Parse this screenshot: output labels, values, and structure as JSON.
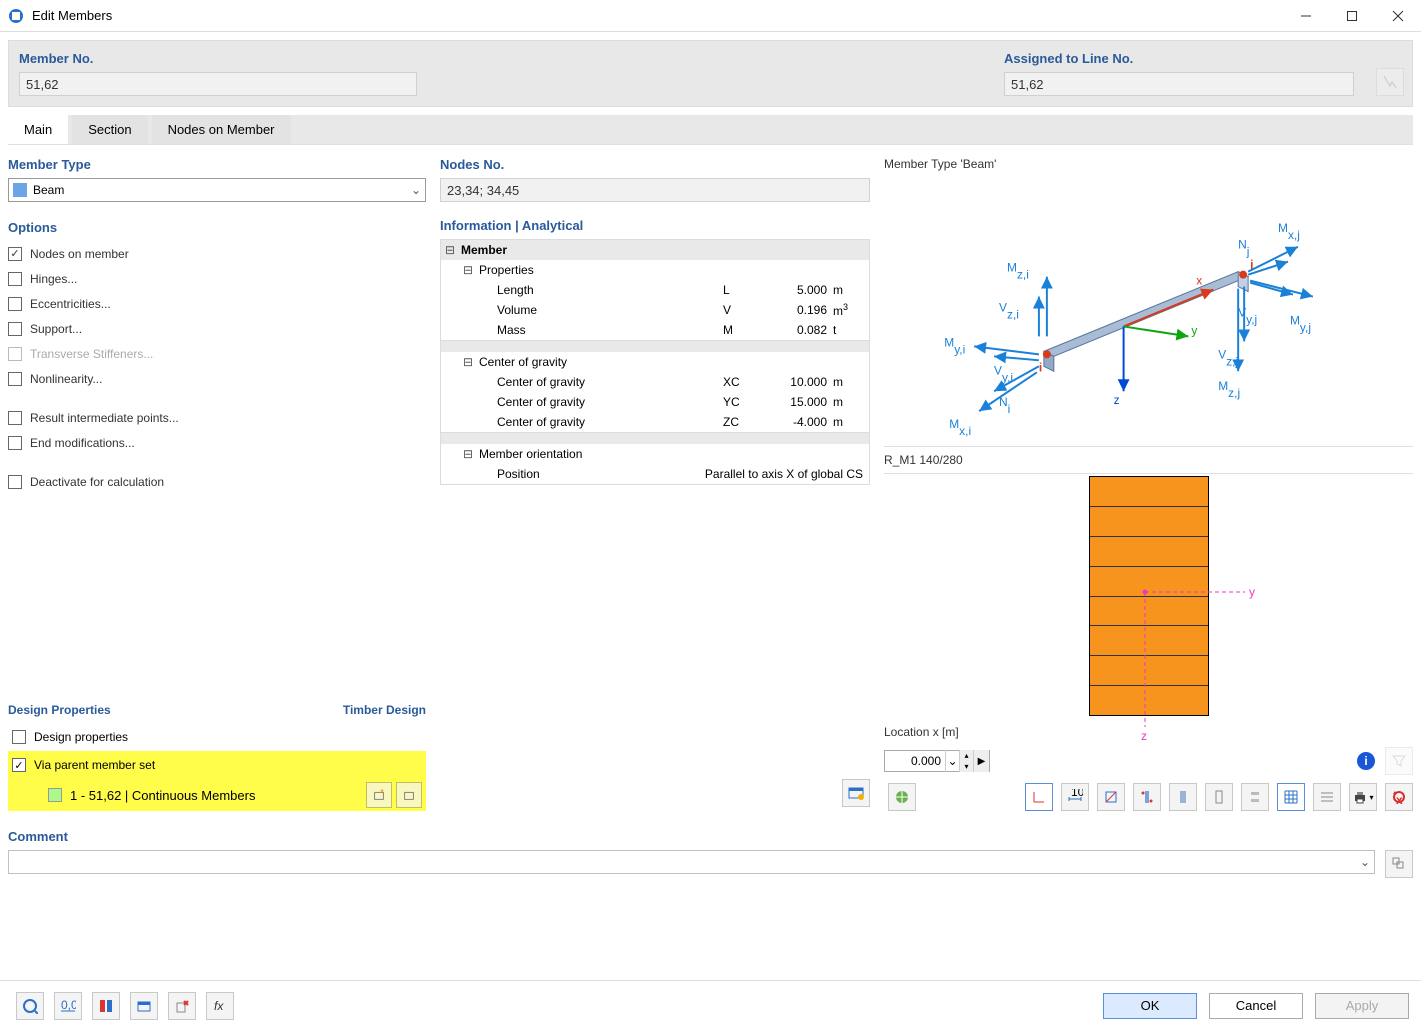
{
  "window": {
    "title": "Edit Members"
  },
  "header": {
    "member_no": {
      "label": "Member No.",
      "value": "51,62"
    },
    "assigned": {
      "label": "Assigned to Line No.",
      "value": "51,62"
    }
  },
  "tabs": [
    "Main",
    "Section",
    "Nodes on Member"
  ],
  "member_type": {
    "label": "Member Type",
    "value": "Beam"
  },
  "options": {
    "label": "Options",
    "items": [
      {
        "label": "Nodes on member",
        "checked": true,
        "disabled": false
      },
      {
        "label": "Hinges...",
        "checked": false,
        "disabled": false
      },
      {
        "label": "Eccentricities...",
        "checked": false,
        "disabled": false
      },
      {
        "label": "Support...",
        "checked": false,
        "disabled": false
      },
      {
        "label": "Transverse Stiffeners...",
        "checked": false,
        "disabled": true
      },
      {
        "label": "Nonlinearity...",
        "checked": false,
        "disabled": false
      },
      {
        "label": "Result intermediate points...",
        "checked": false,
        "disabled": false
      },
      {
        "label": "End modifications...",
        "checked": false,
        "disabled": false
      },
      {
        "label": "Deactivate for calculation",
        "checked": false,
        "disabled": false
      }
    ]
  },
  "design_properties": {
    "label": "Design Properties",
    "right_label": "Timber Design",
    "items": [
      {
        "label": "Design properties",
        "checked": false,
        "highlight": false
      },
      {
        "label": "Via parent member set",
        "checked": true,
        "highlight": true
      }
    ],
    "child": {
      "label": "1 - 51,62 | Continuous Members"
    }
  },
  "nodes_no": {
    "label": "Nodes No.",
    "value": "23,34; 34,45"
  },
  "info_header": "Information | Analytical",
  "info": {
    "member": "Member",
    "properties": "Properties",
    "rows_p": [
      {
        "lbl": "Length",
        "sym": "L",
        "val": "5.000",
        "unit": "m"
      },
      {
        "lbl": "Volume",
        "sym": "V",
        "val": "0.196",
        "unit": "m³"
      },
      {
        "lbl": "Mass",
        "sym": "M",
        "val": "0.082",
        "unit": "t"
      }
    ],
    "cog": "Center of gravity",
    "rows_c": [
      {
        "lbl": "Center of gravity",
        "sym": "XC",
        "val": "10.000",
        "unit": "m"
      },
      {
        "lbl": "Center of gravity",
        "sym": "YC",
        "val": "15.000",
        "unit": "m"
      },
      {
        "lbl": "Center of gravity",
        "sym": "ZC",
        "val": "-4.000",
        "unit": "m"
      }
    ],
    "orient": "Member orientation",
    "pos_lbl": "Position",
    "pos_val": "Parallel to axis X of global CS"
  },
  "right": {
    "diagram_title": "Member Type 'Beam'",
    "section_title": "R_M1 140/280",
    "location_label": "Location x [m]",
    "location_value": "0.000"
  },
  "diagram_labels": {
    "Mxj": "Mx,j",
    "Nj": "Nj",
    "Mzi": "Mz,i",
    "Vzi": "Vz,i",
    "Myi": "My,i",
    "Vyi": "Vy,i",
    "Ni": "Ni",
    "Mxi": "Mx,i",
    "Vyj": "Vy,j",
    "Myj": "My,j",
    "Vzj": "Vz,j",
    "Mzj": "Mz,j",
    "x": "x",
    "y": "y",
    "z": "z",
    "i": "i",
    "j": "j"
  },
  "section_axes": {
    "y": "y",
    "z": "z"
  },
  "comment": {
    "label": "Comment"
  },
  "footer": {
    "ok": "OK",
    "cancel": "Cancel",
    "apply": "Apply"
  }
}
